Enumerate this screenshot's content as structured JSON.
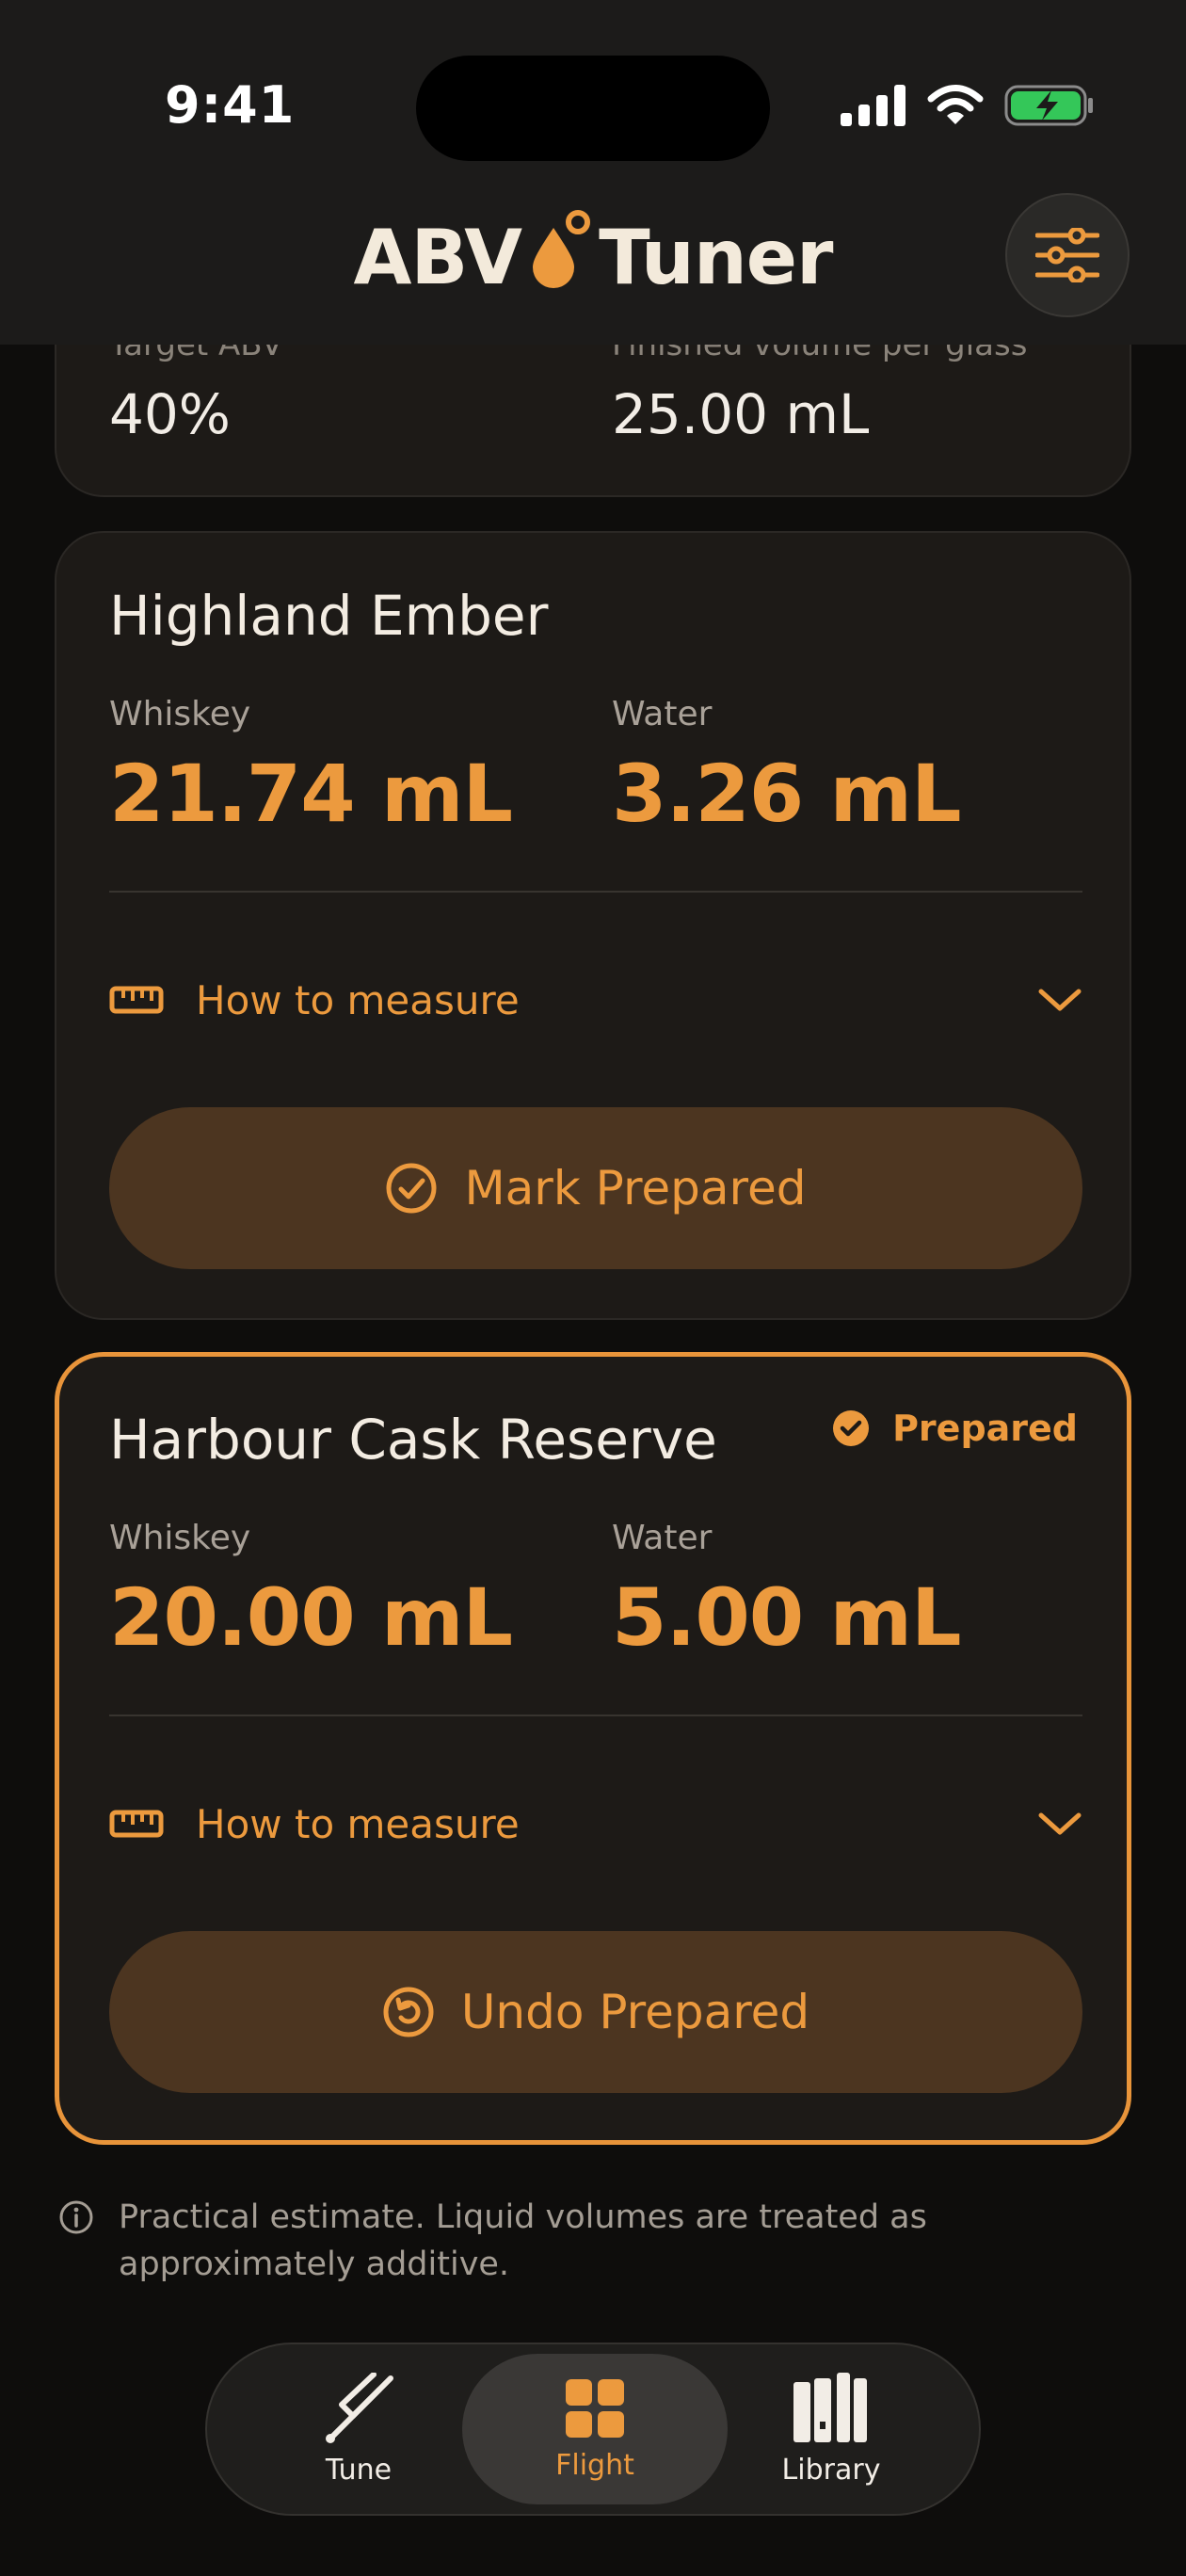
{
  "status": {
    "time": "9:41"
  },
  "header": {
    "title_left": "ABV",
    "title_right": "Tuner"
  },
  "summary": {
    "target_label": "Target ABV",
    "target_value": "40%",
    "volume_label": "Finished volume per glass",
    "volume_value": "25.00 mL"
  },
  "cards": [
    {
      "name": "Highland Ember",
      "whiskey_label": "Whiskey",
      "whiskey_value": "21.74 mL",
      "water_label": "Water",
      "water_value": "3.26 mL",
      "measure_label": "How to measure",
      "action_label": "Mark Prepared",
      "prepared": false
    },
    {
      "name": "Harbour Cask Reserve",
      "badge": "Prepared",
      "whiskey_label": "Whiskey",
      "whiskey_value": "20.00 mL",
      "water_label": "Water",
      "water_value": "5.00 mL",
      "measure_label": "How to measure",
      "action_label": "Undo Prepared",
      "prepared": true
    }
  ],
  "note": "Practical estimate. Liquid volumes are treated as approximately additive.",
  "tabs": [
    {
      "label": "Tune",
      "icon": "tuning-fork-icon"
    },
    {
      "label": "Flight",
      "icon": "grid-icon",
      "active": true
    },
    {
      "label": "Library",
      "icon": "books-icon"
    }
  ],
  "colors": {
    "accent": "#ec9a3e",
    "background": "#0e0d0c",
    "card": "#1d1a17"
  }
}
